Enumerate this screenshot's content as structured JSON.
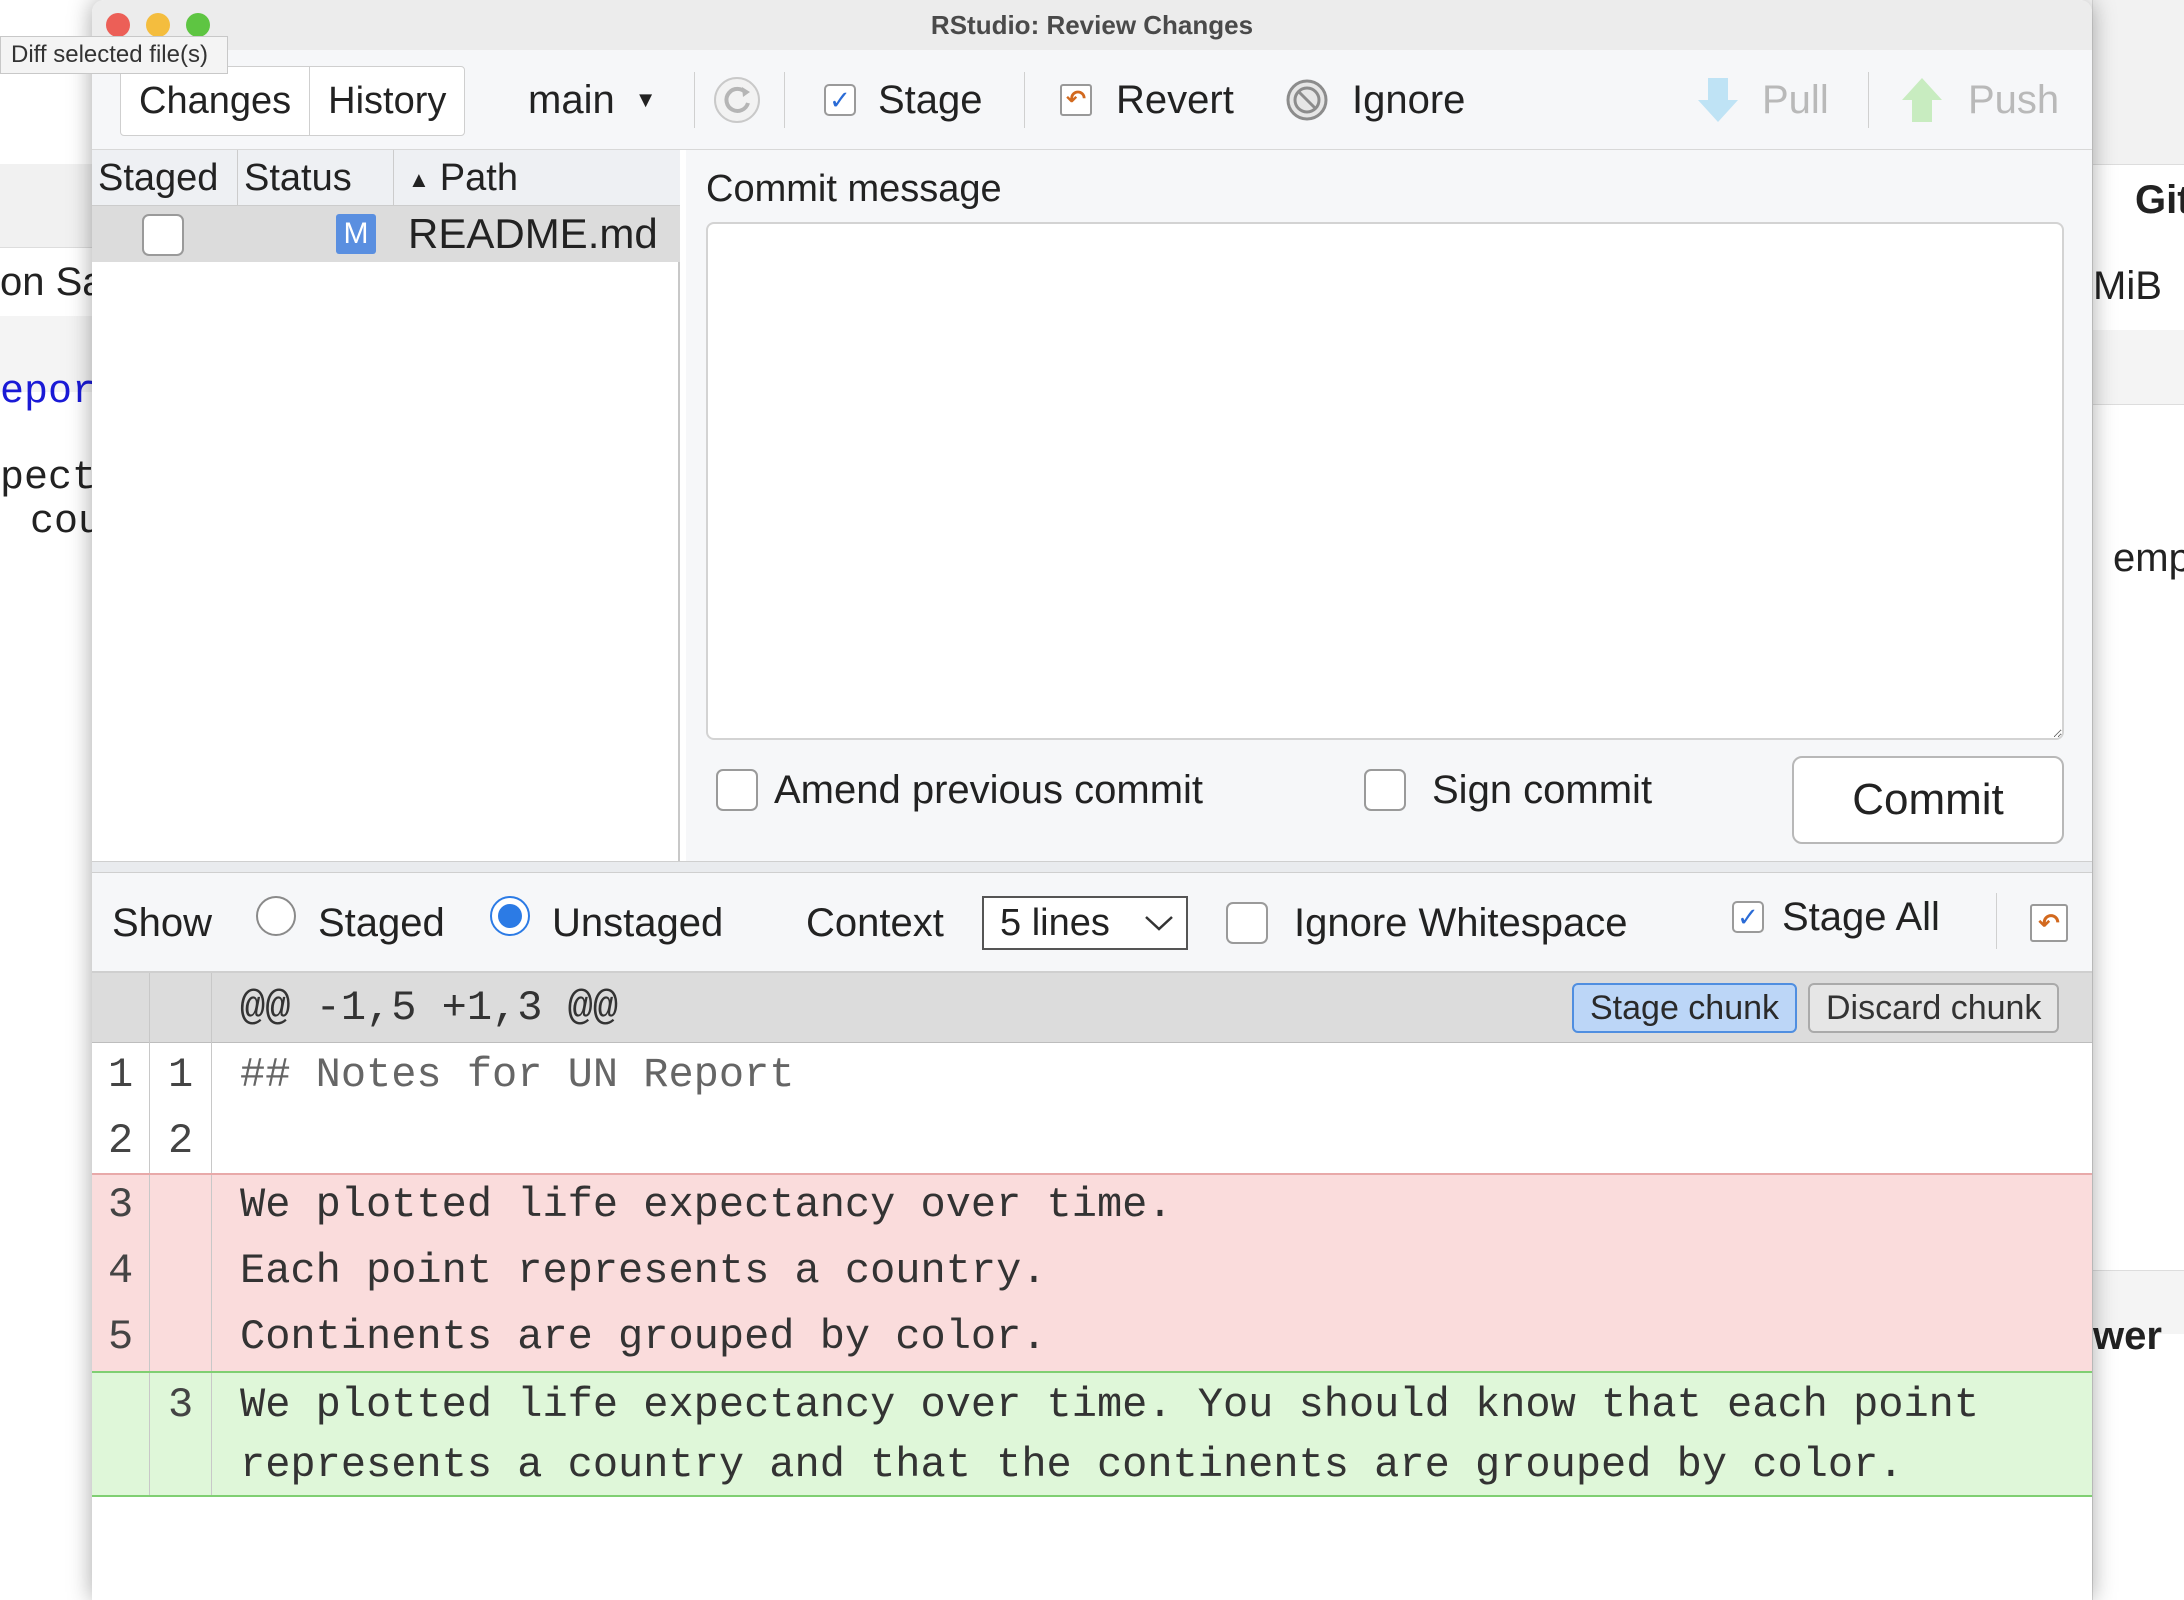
{
  "tooltip": "Diff selected file(s)",
  "background": {
    "left_texts": [
      "on Sa",
      "eport",
      "pect",
      "cou"
    ],
    "right_texts": [
      "Git",
      "MiB",
      "emp",
      "wer"
    ]
  },
  "window": {
    "title": "RStudio: Review Changes"
  },
  "toolbar": {
    "tabs": [
      "Changes",
      "History"
    ],
    "branch": "main",
    "stage_label": "Stage",
    "revert_label": "Revert",
    "ignore_label": "Ignore",
    "pull_label": "Pull",
    "push_label": "Push"
  },
  "file_list": {
    "headers": {
      "staged": "Staged",
      "status": "Status",
      "path": "Path"
    },
    "files": [
      {
        "staged": false,
        "status": "M",
        "path": "README.md"
      }
    ]
  },
  "commit": {
    "label": "Commit message",
    "message": "",
    "amend_label": "Amend previous commit",
    "sign_label": "Sign commit",
    "button_label": "Commit"
  },
  "diff_toolbar": {
    "show_label": "Show",
    "staged_label": "Staged",
    "unstaged_label": "Unstaged",
    "selected_view": "Unstaged",
    "context_label": "Context",
    "context_value": "5 lines",
    "ignore_ws_label": "Ignore Whitespace",
    "ignore_ws_checked": false,
    "stage_all_label": "Stage All",
    "stage_all_checked": true
  },
  "diff": {
    "hunk_header": "@@ -1,5 +1,3 @@",
    "stage_chunk_label": "Stage chunk",
    "discard_chunk_label": "Discard chunk",
    "lines": [
      {
        "old": "1",
        "new": "1",
        "type": "context",
        "text": "## Notes for UN Report"
      },
      {
        "old": "2",
        "new": "2",
        "type": "context",
        "text": ""
      },
      {
        "old": "3",
        "new": "",
        "type": "removed",
        "text": "We plotted life expectancy over time."
      },
      {
        "old": "4",
        "new": "",
        "type": "removed",
        "text": "Each point represents a country."
      },
      {
        "old": "5",
        "new": "",
        "type": "removed",
        "text": "Continents are grouped by color."
      },
      {
        "old": "",
        "new": "3",
        "type": "added",
        "text": "We plotted life expectancy over time. You should know that each point",
        "text_cont": "represents a country and that the continents are grouped by color."
      }
    ]
  },
  "colors": {
    "removed_bg": "#fadcdc",
    "added_bg": "#dff7d9",
    "accent": "#2c7be5",
    "hunk_bg": "#dcdcdc"
  }
}
